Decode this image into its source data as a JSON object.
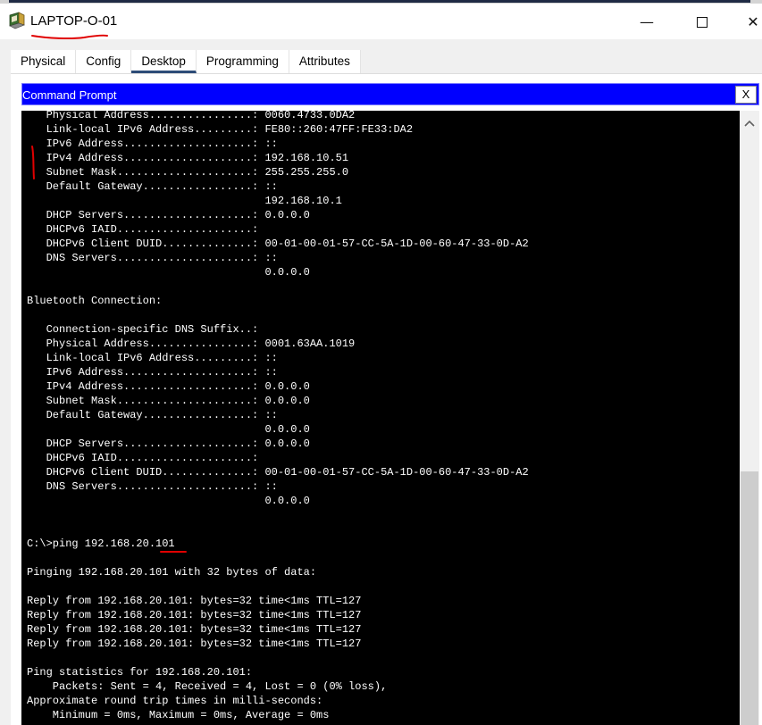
{
  "window": {
    "title": "LAPTOP-O-01",
    "minimize_glyph": "—",
    "close_glyph": "✕",
    "icon": "laptop-app-icon"
  },
  "tabs": [
    {
      "label": "Physical"
    },
    {
      "label": "Config"
    },
    {
      "label": "Desktop",
      "active": true
    },
    {
      "label": "Programming"
    },
    {
      "label": "Attributes"
    }
  ],
  "command_prompt": {
    "title": "Command Prompt",
    "close_label": "X",
    "header_color": "#0000ff"
  },
  "terminal": {
    "lines": [
      "   Physical Address................: 0060.4733.0DA2",
      "   Link-local IPv6 Address.........: FE80::260:47FF:FE33:DA2",
      "   IPv6 Address....................: ::",
      "   IPv4 Address....................: 192.168.10.51",
      "   Subnet Mask.....................: 255.255.255.0",
      "   Default Gateway.................: ::",
      "                                     192.168.10.1",
      "   DHCP Servers....................: 0.0.0.0",
      "   DHCPv6 IAID.....................:",
      "   DHCPv6 Client DUID..............: 00-01-00-01-57-CC-5A-1D-00-60-47-33-0D-A2",
      "   DNS Servers.....................: ::",
      "                                     0.0.0.0",
      "",
      "Bluetooth Connection:",
      "",
      "   Connection-specific DNS Suffix..:",
      "   Physical Address................: 0001.63AA.1019",
      "   Link-local IPv6 Address.........: ::",
      "   IPv6 Address....................: ::",
      "   IPv4 Address....................: 0.0.0.0",
      "   Subnet Mask.....................: 0.0.0.0",
      "   Default Gateway.................: ::",
      "                                     0.0.0.0",
      "   DHCP Servers....................: 0.0.0.0",
      "   DHCPv6 IAID.....................:",
      "   DHCPv6 Client DUID..............: 00-01-00-01-57-CC-5A-1D-00-60-47-33-0D-A2",
      "   DNS Servers.....................: ::",
      "                                     0.0.0.0",
      "",
      "",
      "C:\\>ping 192.168.20.101",
      "",
      "Pinging 192.168.20.101 with 32 bytes of data:",
      "",
      "Reply from 192.168.20.101: bytes=32 time<1ms TTL=127",
      "Reply from 192.168.20.101: bytes=32 time<1ms TTL=127",
      "Reply from 192.168.20.101: bytes=32 time<1ms TTL=127",
      "Reply from 192.168.20.101: bytes=32 time<1ms TTL=127",
      "",
      "Ping statistics for 192.168.20.101:",
      "    Packets: Sent = 4, Received = 4, Lost = 0 (0% loss),",
      "Approximate round trip times in milli-seconds:",
      "    Minimum = 0ms, Maximum = 0ms, Average = 0ms"
    ]
  },
  "scrollbar": {
    "up_icon": "chevron-up-icon"
  },
  "colors": {
    "annotation": "#e00000",
    "tab_active_underline": "#2d4c77",
    "terminal_bg": "#000000",
    "terminal_fg": "#ffffff"
  }
}
